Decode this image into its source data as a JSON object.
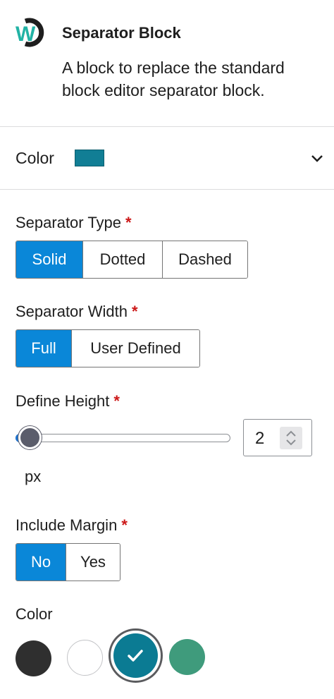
{
  "block": {
    "logo_text": "W",
    "title": "Separator Block",
    "description": "A block to replace the standard block editor separator block."
  },
  "panel": {
    "title": "Color",
    "swatch_color": "#117e95",
    "chevron": "chevron-down-icon"
  },
  "separator_type": {
    "label": "Separator Type",
    "required_mark": "*",
    "options": [
      "Solid",
      "Dotted",
      "Dashed"
    ],
    "selected": "Solid"
  },
  "separator_width": {
    "label": "Separator Width",
    "required_mark": "*",
    "options": [
      "Full",
      "User Defined"
    ],
    "selected": "Full"
  },
  "define_height": {
    "label": "Define Height",
    "required_mark": "*",
    "value": "2",
    "unit": "px"
  },
  "include_margin": {
    "label": "Include Margin",
    "required_mark": "*",
    "options": [
      "No",
      "Yes"
    ],
    "selected": "No"
  },
  "color": {
    "label": "Color",
    "swatches": [
      "#2f2f2f",
      "#ffffff",
      "#0b7b93",
      "#3f9b7c"
    ],
    "selected": "#0b7b93"
  },
  "colors": {
    "accent": "#0a87d8",
    "required": "#cc1818"
  }
}
